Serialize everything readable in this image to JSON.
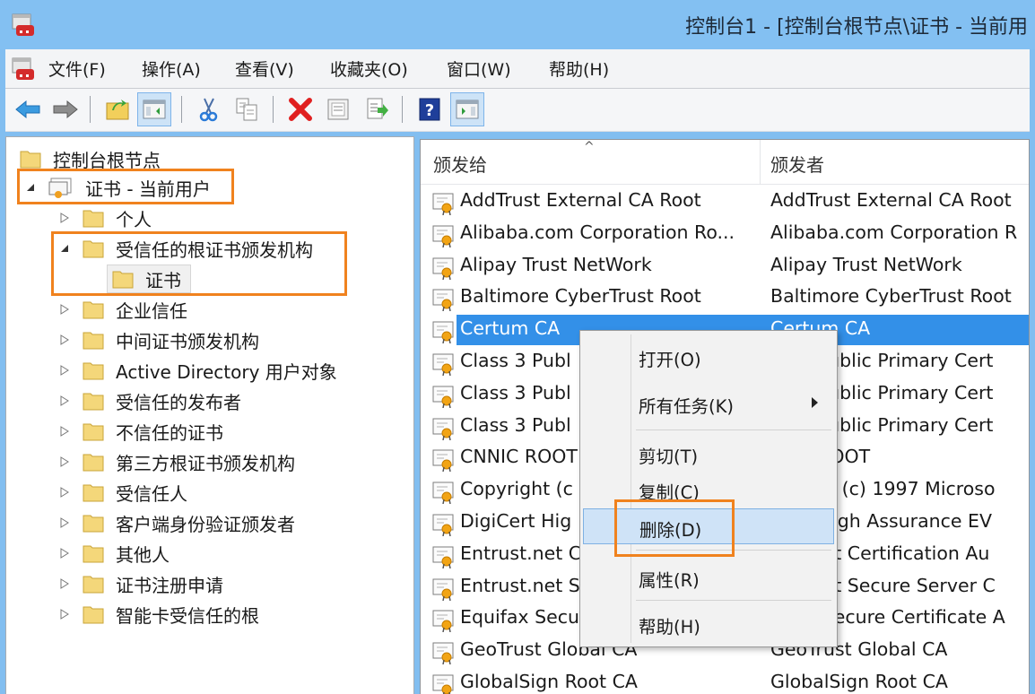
{
  "window": {
    "title": "控制台1 - [控制台根节点\\证书 - 当前用"
  },
  "menu": {
    "items": [
      {
        "label": "文件(F)"
      },
      {
        "label": "操作(A)"
      },
      {
        "label": "查看(V)"
      },
      {
        "label": "收藏夹(O)"
      },
      {
        "label": "窗口(W)"
      },
      {
        "label": "帮助(H)"
      }
    ]
  },
  "toolbar": {
    "buttons": [
      {
        "icon": "back-arrow-icon"
      },
      {
        "icon": "forward-arrow-icon"
      },
      {
        "icon": "up-folder-icon"
      },
      {
        "icon": "show-hide-console-tree-icon",
        "pressed": true
      },
      {
        "icon": "cut-icon"
      },
      {
        "icon": "copy-icon"
      },
      {
        "icon": "delete-icon"
      },
      {
        "icon": "properties-icon"
      },
      {
        "icon": "export-list-icon"
      },
      {
        "icon": "help-icon"
      },
      {
        "icon": "show-hide-action-pane-icon",
        "pressed": true
      }
    ]
  },
  "tree": {
    "root": "控制台根节点",
    "store": "证书 - 当前用户",
    "items": [
      {
        "label": "个人",
        "expanded": false
      },
      {
        "label": "受信任的根证书颁发机构",
        "expanded": true,
        "children": [
          {
            "label": "证书",
            "selected": true
          }
        ]
      },
      {
        "label": "企业信任",
        "expanded": false
      },
      {
        "label": "中间证书颁发机构",
        "expanded": false
      },
      {
        "label": "Active Directory 用户对象",
        "expanded": false
      },
      {
        "label": "受信任的发布者",
        "expanded": false
      },
      {
        "label": "不信任的证书",
        "expanded": false
      },
      {
        "label": "第三方根证书颁发机构",
        "expanded": false
      },
      {
        "label": "受信任人",
        "expanded": false
      },
      {
        "label": "客户端身份验证颁发者",
        "expanded": false
      },
      {
        "label": "其他人",
        "expanded": false
      },
      {
        "label": "证书注册申请",
        "expanded": false
      },
      {
        "label": "智能卡受信任的根",
        "expanded": false
      }
    ]
  },
  "list": {
    "columns": [
      {
        "label": "颁发给",
        "sorted": "ascending"
      },
      {
        "label": "颁发者"
      }
    ],
    "rows": [
      {
        "issued_to": "AddTrust External CA Root",
        "issued_by": "AddTrust External CA Root"
      },
      {
        "issued_to": "Alibaba.com Corporation Ro...",
        "issued_by": "Alibaba.com Corporation R"
      },
      {
        "issued_to": "Alipay Trust NetWork",
        "issued_by": "Alipay Trust NetWork"
      },
      {
        "issued_to": "Baltimore CyberTrust Root",
        "issued_by": "Baltimore CyberTrust Root"
      },
      {
        "issued_to": "Certum CA",
        "issued_by": "Certum CA",
        "selected": true
      },
      {
        "issued_to": "Class 3 Publ",
        "issued_by": "        Public Primary Cert"
      },
      {
        "issued_to": "Class 3 Publ",
        "issued_by": "        Public Primary Cert"
      },
      {
        "issued_to": "Class 3 Publ",
        "issued_by": "        Public Primary Cert"
      },
      {
        "issued_to": "CNNIC ROOT",
        "issued_by": "        ROOT"
      },
      {
        "issued_to": "Copyright (c",
        "issued_by": "      ght (c) 1997 Microso"
      },
      {
        "issued_to": "DigiCert Hig",
        "issued_by": "      t High Assurance EV"
      },
      {
        "issued_to": "Entrust.net C",
        "issued_by": "      .net Certification Au"
      },
      {
        "issued_to": "Entrust.net S",
        "issued_by": "      .net Secure Server C"
      },
      {
        "issued_to": "Equifax Secu",
        "issued_by": "      x Secure Certificate A"
      },
      {
        "issued_to": "GeoTrust Global CA",
        "issued_by": "GeoTrust Global CA"
      },
      {
        "issued_to": "GlobalSign Root CA",
        "issued_by": "GlobalSign Root CA"
      }
    ]
  },
  "context_menu": {
    "items": [
      {
        "label": "打开(O)"
      },
      {
        "label": "所有任务(K)",
        "submenu": true
      },
      {
        "label": "剪切(T)"
      },
      {
        "label": "复制(C)"
      },
      {
        "label": "删除(D)",
        "highlighted": true
      },
      {
        "label": "属性(R)"
      },
      {
        "label": "帮助(H)"
      }
    ]
  },
  "colors": {
    "title_bar": "#83c0f2",
    "selection": "#3390e8",
    "highlight_outline": "#f0821e",
    "menu_hover": "#cfe3f7"
  }
}
